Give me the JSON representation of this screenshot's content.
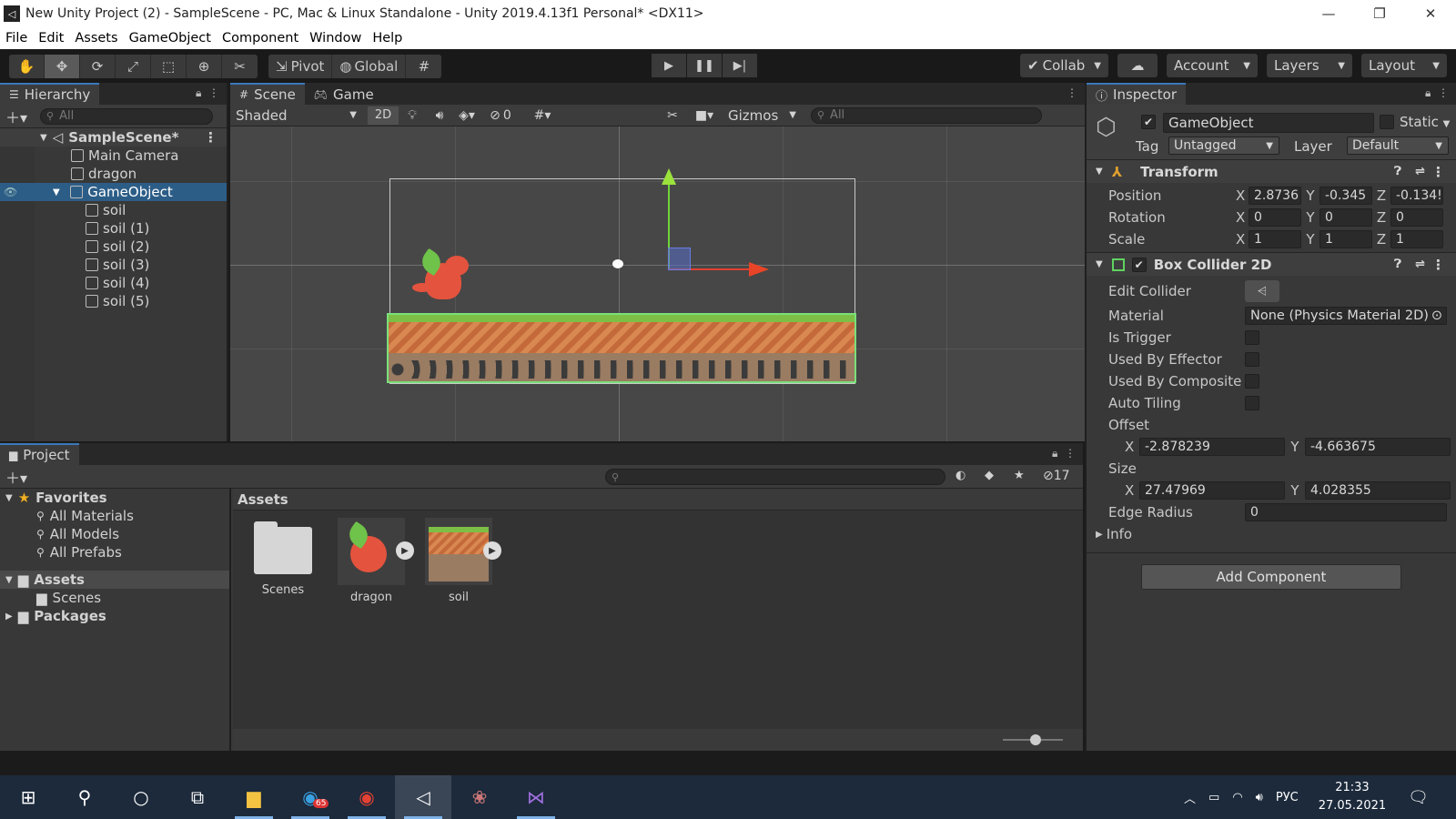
{
  "window": {
    "title": "New Unity Project (2) - SampleScene - PC, Mac & Linux Standalone - Unity 2019.4.13f1 Personal* <DX11>"
  },
  "menu": [
    "File",
    "Edit",
    "Assets",
    "GameObject",
    "Component",
    "Window",
    "Help"
  ],
  "toolbar": {
    "pivot": "Pivot",
    "global": "Global",
    "collab": "Collab",
    "account": "Account",
    "layers": "Layers",
    "layout": "Layout"
  },
  "hierarchy": {
    "tab": "Hierarchy",
    "search_placeholder": "All",
    "scene": "SampleScene*",
    "items": [
      "Main Camera",
      "dragon",
      "GameObject",
      "soil",
      "soil (1)",
      "soil (2)",
      "soil (3)",
      "soil (4)",
      "soil (5)"
    ]
  },
  "scene": {
    "tab_scene": "Scene",
    "tab_game": "Game",
    "shading": "Shaded",
    "mode2d": "2D",
    "hidden_count": "0",
    "gizmos": "Gizmos",
    "search_placeholder": "All"
  },
  "inspector": {
    "tab": "Inspector",
    "object_name": "GameObject",
    "static": "Static",
    "tag_label": "Tag",
    "tag": "Untagged",
    "layer_label": "Layer",
    "layer": "Default",
    "transform": {
      "title": "Transform",
      "position_label": "Position",
      "position": {
        "x": "2.8736",
        "y": "-0.345",
        "z": "-0.134!"
      },
      "rotation_label": "Rotation",
      "rotation": {
        "x": "0",
        "y": "0",
        "z": "0"
      },
      "scale_label": "Scale",
      "scale": {
        "x": "1",
        "y": "1",
        "z": "1"
      }
    },
    "collider": {
      "title": "Box Collider 2D",
      "edit_collider": "Edit Collider",
      "material_label": "Material",
      "material": "None (Physics Material 2D)",
      "is_trigger": "Is Trigger",
      "used_by_effector": "Used By Effector",
      "used_by_composite": "Used By Composite",
      "auto_tiling": "Auto Tiling",
      "offset_label": "Offset",
      "offset": {
        "x": "-2.878239",
        "y": "-4.663675"
      },
      "size_label": "Size",
      "size": {
        "x": "27.47969",
        "y": "4.028355"
      },
      "edge_radius_label": "Edge Radius",
      "edge_radius": "0",
      "info": "Info"
    },
    "add_component": "Add Component"
  },
  "project": {
    "tab": "Project",
    "hidden_count": "17",
    "favorites": "Favorites",
    "fav_items": [
      "All Materials",
      "All Models",
      "All Prefabs"
    ],
    "assets": "Assets",
    "asset_folders": [
      "Scenes"
    ],
    "packages": "Packages",
    "breadcrumb": "Assets",
    "grid": [
      "Scenes",
      "dragon",
      "soil"
    ]
  },
  "taskbar": {
    "lang": "РУС",
    "time": "21:33",
    "date": "27.05.2021",
    "telegram_badge": "65"
  }
}
